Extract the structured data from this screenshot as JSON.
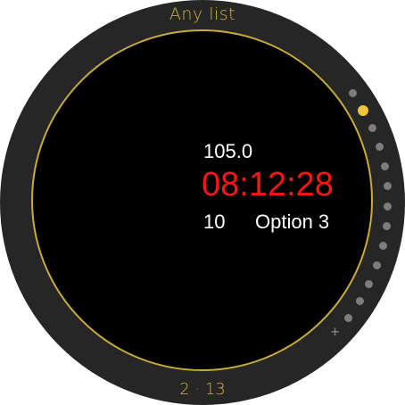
{
  "header": {
    "title": "Any list"
  },
  "content": {
    "value_line": "105.0",
    "time": "08:12:28",
    "count": "10",
    "option": "Option 3"
  },
  "footer": {
    "page_indicator": "2 · 13"
  },
  "pager": {
    "total_pages": 13,
    "active_page": 2,
    "has_add": true,
    "add_glyph": "+"
  },
  "colors": {
    "accent": "#d4b23a",
    "time": "#ff1414",
    "bezel": "#262626",
    "dot": "#7d7d7d",
    "active_dot": "#f2c63a"
  }
}
